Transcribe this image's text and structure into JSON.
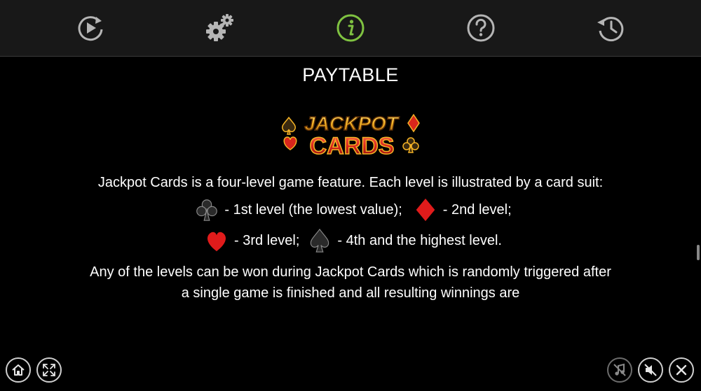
{
  "toolbar": {
    "items": [
      {
        "name": "autoplay",
        "icon": "autoplay-icon",
        "active": false
      },
      {
        "name": "settings",
        "icon": "gears-icon",
        "active": false
      },
      {
        "name": "info",
        "icon": "info-icon",
        "active": true
      },
      {
        "name": "help",
        "icon": "question-icon",
        "active": false
      },
      {
        "name": "history",
        "icon": "history-icon",
        "active": false
      }
    ],
    "active_color": "#7fc241",
    "inactive_color": "#b5b5b5"
  },
  "page": {
    "title": "PAYTABLE",
    "logo_line1": "JACKPOT",
    "logo_line2": "CARDS",
    "intro": "Jackpot Cards is a four-level game feature. Each level is illustrated by a card suit:",
    "levels": [
      {
        "suit": "club-icon",
        "text": "- 1st level (the lowest value);"
      },
      {
        "suit": "diamond-icon",
        "text": "- 2nd level;"
      },
      {
        "suit": "heart-icon",
        "text": "- 3rd level;"
      },
      {
        "suit": "spade-icon",
        "text": "- 4th and the highest level."
      }
    ],
    "para2": "Any of the levels can be won during Jackpot Cards which is randomly triggered after a single game is finished and all resulting winnings are"
  },
  "bottom": {
    "left": [
      {
        "name": "home",
        "icon": "home-icon"
      },
      {
        "name": "fullscreen",
        "icon": "fullscreen-icon"
      }
    ],
    "right": [
      {
        "name": "music-off",
        "icon": "music-off-icon"
      },
      {
        "name": "sound-off",
        "icon": "sound-off-icon"
      },
      {
        "name": "close",
        "icon": "close-icon"
      }
    ]
  },
  "colors": {
    "suit_red": "#e01b1b",
    "suit_dark": "#2a2a2a",
    "logo_gold": "#f5b325",
    "logo_red": "#d8261c"
  }
}
